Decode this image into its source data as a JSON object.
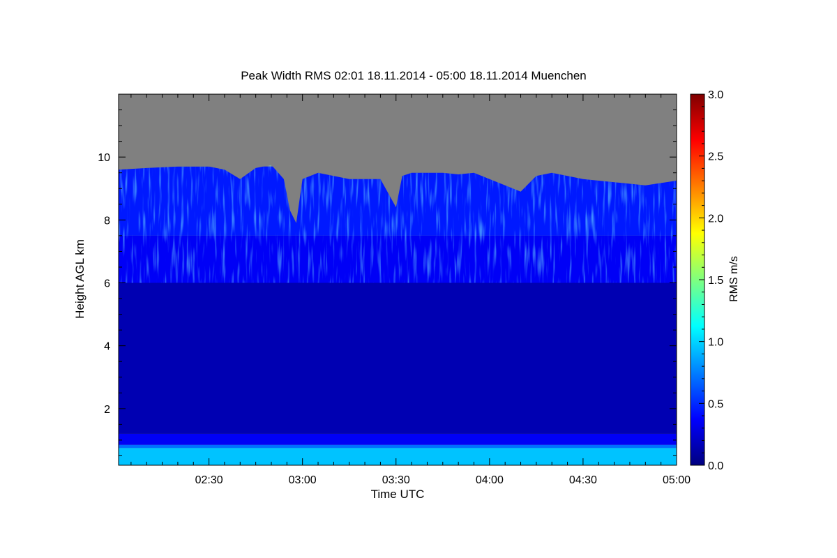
{
  "chart_data": {
    "type": "heatmap",
    "title": "Peak Width RMS   02:01 18.11.2014 - 05:00 18.11.2014 Muenchen",
    "xlabel": "Time UTC",
    "ylabel": "Height AGL km",
    "colorbar_label": "RMS m/s",
    "x_range_minutes": [
      121,
      300
    ],
    "x_ticks": [
      {
        "minute": 150,
        "label": "02:30"
      },
      {
        "minute": 180,
        "label": "03:00"
      },
      {
        "minute": 210,
        "label": "03:30"
      },
      {
        "minute": 240,
        "label": "04:00"
      },
      {
        "minute": 270,
        "label": "04:30"
      },
      {
        "minute": 300,
        "label": "05:00"
      }
    ],
    "y_range": [
      0.2,
      12.0
    ],
    "y_ticks": [
      {
        "value": 2,
        "label": "2"
      },
      {
        "value": 4,
        "label": "4"
      },
      {
        "value": 6,
        "label": "6"
      },
      {
        "value": 8,
        "label": "8"
      },
      {
        "value": 10,
        "label": "10"
      }
    ],
    "colorbar_range": [
      0.0,
      3.0
    ],
    "colorbar_ticks": [
      {
        "value": 0.0,
        "label": "0.0"
      },
      {
        "value": 0.5,
        "label": "0.5"
      },
      {
        "value": 1.0,
        "label": "1.0"
      },
      {
        "value": 1.5,
        "label": "1.5"
      },
      {
        "value": 2.0,
        "label": "2.0"
      },
      {
        "value": 2.5,
        "label": "2.5"
      },
      {
        "value": 3.0,
        "label": "3.0"
      }
    ],
    "colormap": [
      "#00007f",
      "#0000ff",
      "#007fff",
      "#00ffff",
      "#7fff7f",
      "#ffff00",
      "#ff7f00",
      "#ff0000",
      "#7f0000"
    ],
    "no_data_color": "#808080",
    "bands": [
      {
        "from_km": 0.2,
        "to_km": 0.75,
        "rms": 0.95
      },
      {
        "from_km": 0.75,
        "to_km": 0.85,
        "rms": 0.7
      },
      {
        "from_km": 0.85,
        "to_km": 1.2,
        "rms": 0.35
      },
      {
        "from_km": 1.2,
        "to_km": 6.0,
        "rms": 0.15
      },
      {
        "from_km": 6.0,
        "to_km": 7.5,
        "rms": 0.35
      },
      {
        "from_km": 7.5,
        "to_km": 9.7,
        "rms": 0.45
      }
    ],
    "echo_top_km": [
      {
        "minute": 121,
        "value": 9.6
      },
      {
        "minute": 130,
        "value": 9.65
      },
      {
        "minute": 140,
        "value": 9.7
      },
      {
        "minute": 150,
        "value": 9.7
      },
      {
        "minute": 155,
        "value": 9.6
      },
      {
        "minute": 160,
        "value": 9.3
      },
      {
        "minute": 165,
        "value": 9.65
      },
      {
        "minute": 170,
        "value": 9.75
      },
      {
        "minute": 174,
        "value": 9.3
      },
      {
        "minute": 176,
        "value": 8.3
      },
      {
        "minute": 178,
        "value": 7.9
      },
      {
        "minute": 180,
        "value": 9.3
      },
      {
        "minute": 185,
        "value": 9.5
      },
      {
        "minute": 190,
        "value": 9.4
      },
      {
        "minute": 195,
        "value": 9.3
      },
      {
        "minute": 200,
        "value": 9.3
      },
      {
        "minute": 205,
        "value": 9.3
      },
      {
        "minute": 210,
        "value": 8.4
      },
      {
        "minute": 212,
        "value": 9.4
      },
      {
        "minute": 215,
        "value": 9.5
      },
      {
        "minute": 220,
        "value": 9.5
      },
      {
        "minute": 225,
        "value": 9.5
      },
      {
        "minute": 230,
        "value": 9.45
      },
      {
        "minute": 235,
        "value": 9.5
      },
      {
        "minute": 240,
        "value": 9.3
      },
      {
        "minute": 245,
        "value": 9.1
      },
      {
        "minute": 250,
        "value": 8.9
      },
      {
        "minute": 255,
        "value": 9.4
      },
      {
        "minute": 260,
        "value": 9.5
      },
      {
        "minute": 265,
        "value": 9.4
      },
      {
        "minute": 270,
        "value": 9.3
      },
      {
        "minute": 280,
        "value": 9.2
      },
      {
        "minute": 290,
        "value": 9.1
      },
      {
        "minute": 300,
        "value": 9.25
      }
    ],
    "grid": false,
    "legend": "colorbar-right"
  }
}
